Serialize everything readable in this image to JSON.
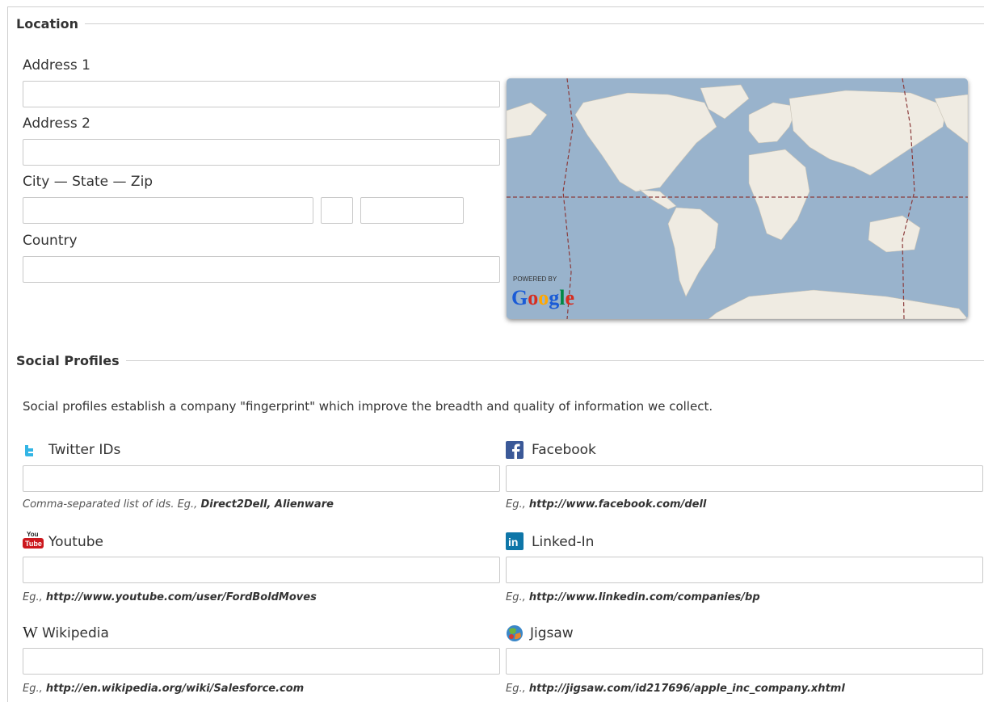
{
  "location": {
    "legend": "Location",
    "address1_label": "Address 1",
    "address1_value": "",
    "address2_label": "Address 2",
    "address2_value": "",
    "city_state_zip_label": "City — State — Zip",
    "city_value": "",
    "state_value": "",
    "zip_value": "",
    "country_label": "Country",
    "country_value": "",
    "map": {
      "powered_by": "POWERED BY",
      "brand": "Google"
    }
  },
  "social": {
    "legend": "Social Profiles",
    "description": "Social profiles establish a company \"fingerprint\" which improve the breadth and quality of information we collect.",
    "twitter": {
      "label": "Twitter IDs",
      "icon": "twitter-icon",
      "value": "",
      "hint_prefix": "Comma-separated list of ids. Eg., ",
      "hint_example": "Direct2Dell, Alienware"
    },
    "facebook": {
      "label": "Facebook",
      "icon": "facebook-icon",
      "value": "",
      "hint_prefix": "Eg., ",
      "hint_example": "http://www.facebook.com/dell"
    },
    "youtube": {
      "label": "Youtube",
      "icon": "youtube-icon",
      "value": "",
      "hint_prefix": "Eg., ",
      "hint_example": "http://www.youtube.com/user/FordBoldMoves"
    },
    "linkedin": {
      "label": "Linked-In",
      "icon": "linkedin-icon",
      "value": "",
      "hint_prefix": "Eg., ",
      "hint_example": "http://www.linkedin.com/companies/bp"
    },
    "wikipedia": {
      "label": "Wikipedia",
      "icon": "wikipedia-icon",
      "value": "",
      "hint_prefix": "Eg., ",
      "hint_example": "http://en.wikipedia.org/wiki/Salesforce.com"
    },
    "jigsaw": {
      "label": "Jigsaw",
      "icon": "jigsaw-icon",
      "value": "",
      "hint_prefix": "Eg., ",
      "hint_example": "http://jigsaw.com/id217696/apple_inc_company.xhtml"
    }
  },
  "colors": {
    "twitter": "#33b5e5",
    "facebook": "#3b5998",
    "youtube": "#cc181e",
    "linkedin": "#0e76a8",
    "ocean": "#99b3cc",
    "land": "#efebe2"
  }
}
